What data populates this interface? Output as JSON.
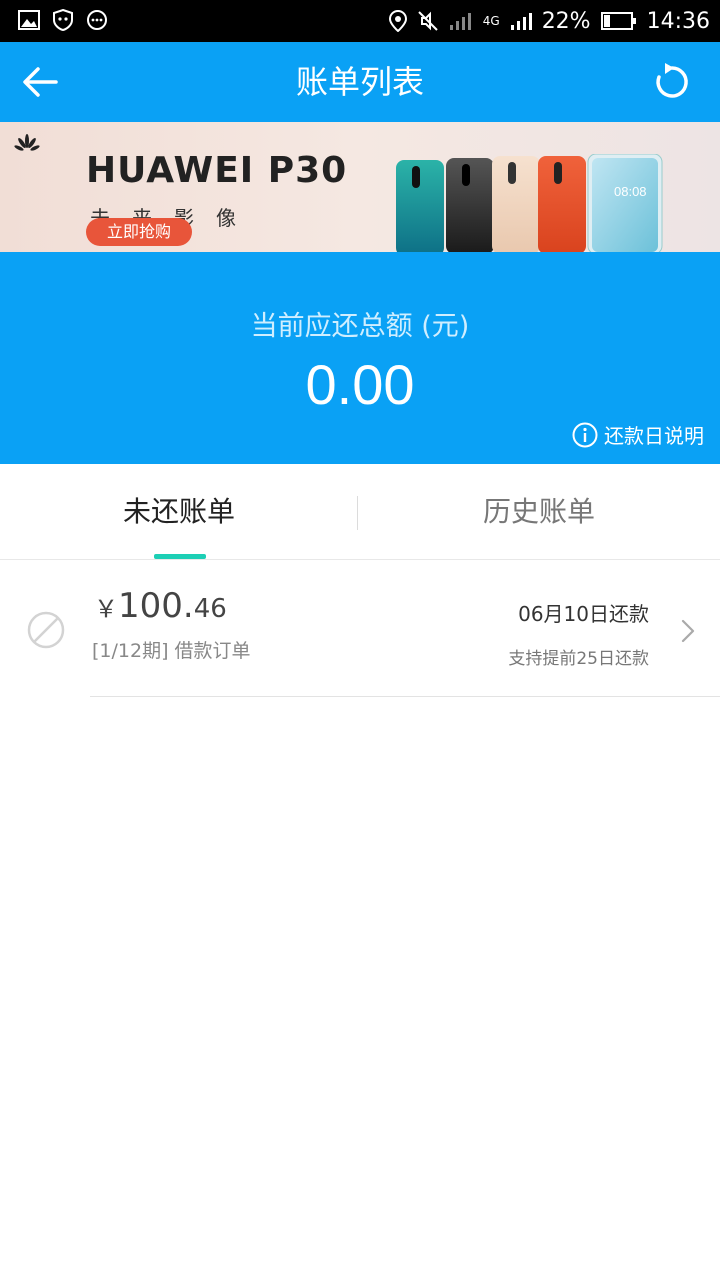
{
  "status_bar": {
    "battery": "22%",
    "time": "14:36",
    "network": "4G"
  },
  "app_bar": {
    "title": "账单列表"
  },
  "banner": {
    "brand": "HUAWEI  P30",
    "slogan": "未来影像",
    "button": "立即抢购",
    "phone_screen_time": "08:08"
  },
  "summary": {
    "label": "当前应还总额 (元)",
    "amount": "0.00",
    "explain": "还款日说明"
  },
  "tabs": [
    {
      "label": "未还账单",
      "active": true
    },
    {
      "label": "历史账单",
      "active": false
    }
  ],
  "bills": [
    {
      "currency": "￥",
      "amount_int": "100.",
      "amount_dec": "46",
      "period": "[1/12期] 借款订单",
      "due": "06月10日还款",
      "early": "支持提前25日还款"
    }
  ],
  "colors": {
    "primary": "#0aa1f5",
    "tab_indicator": "#1dcfb5",
    "buy_button": "#e8553a"
  }
}
